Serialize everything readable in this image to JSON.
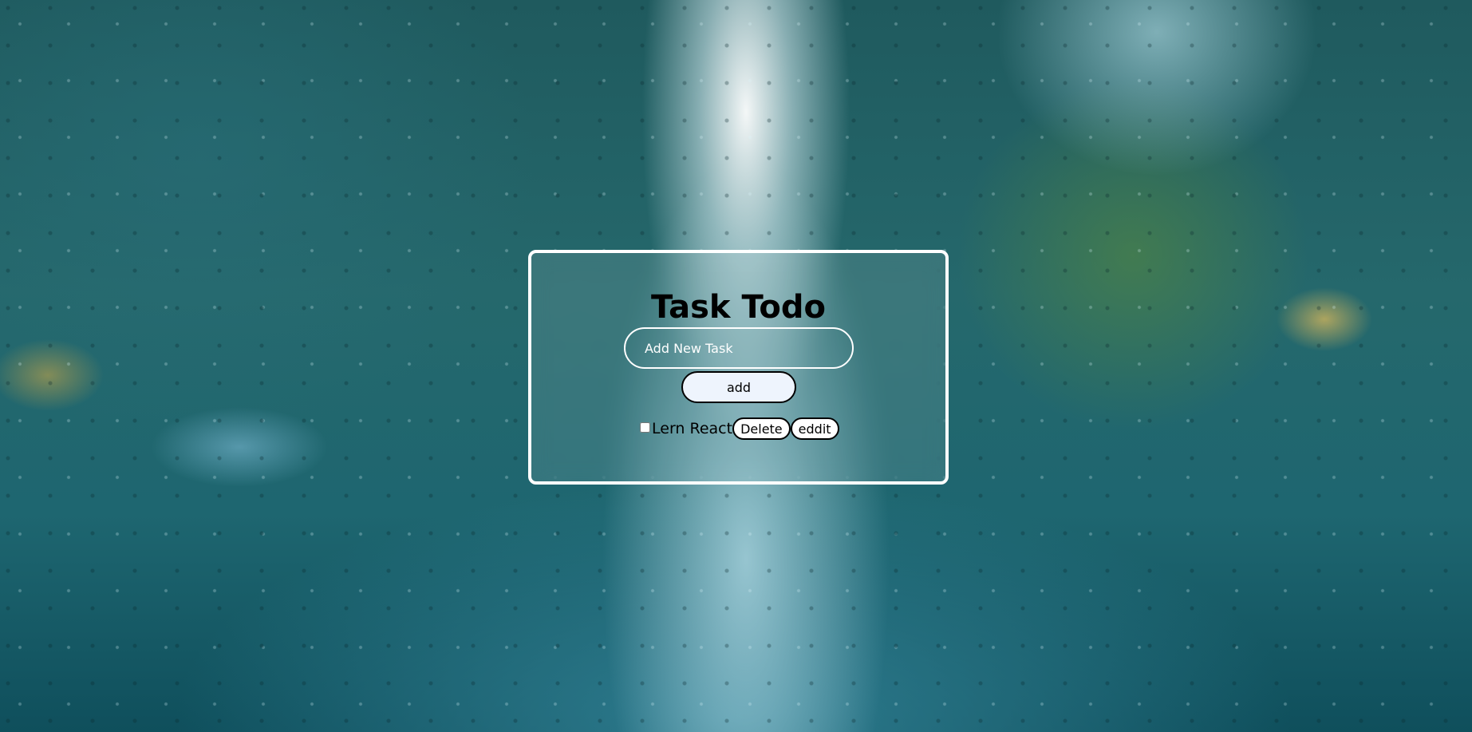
{
  "app": {
    "title": "Task Todo"
  },
  "new_task": {
    "placeholder": "Add New Task",
    "value": ""
  },
  "add_button": {
    "label": "add"
  },
  "tasks": [
    {
      "label": "Lern React",
      "checked": false,
      "delete_label": "Delete",
      "edit_label": "eddit"
    }
  ],
  "colors": {
    "card_border": "#ffffff",
    "text": "#000000",
    "button_fill": "#eef4fd"
  }
}
